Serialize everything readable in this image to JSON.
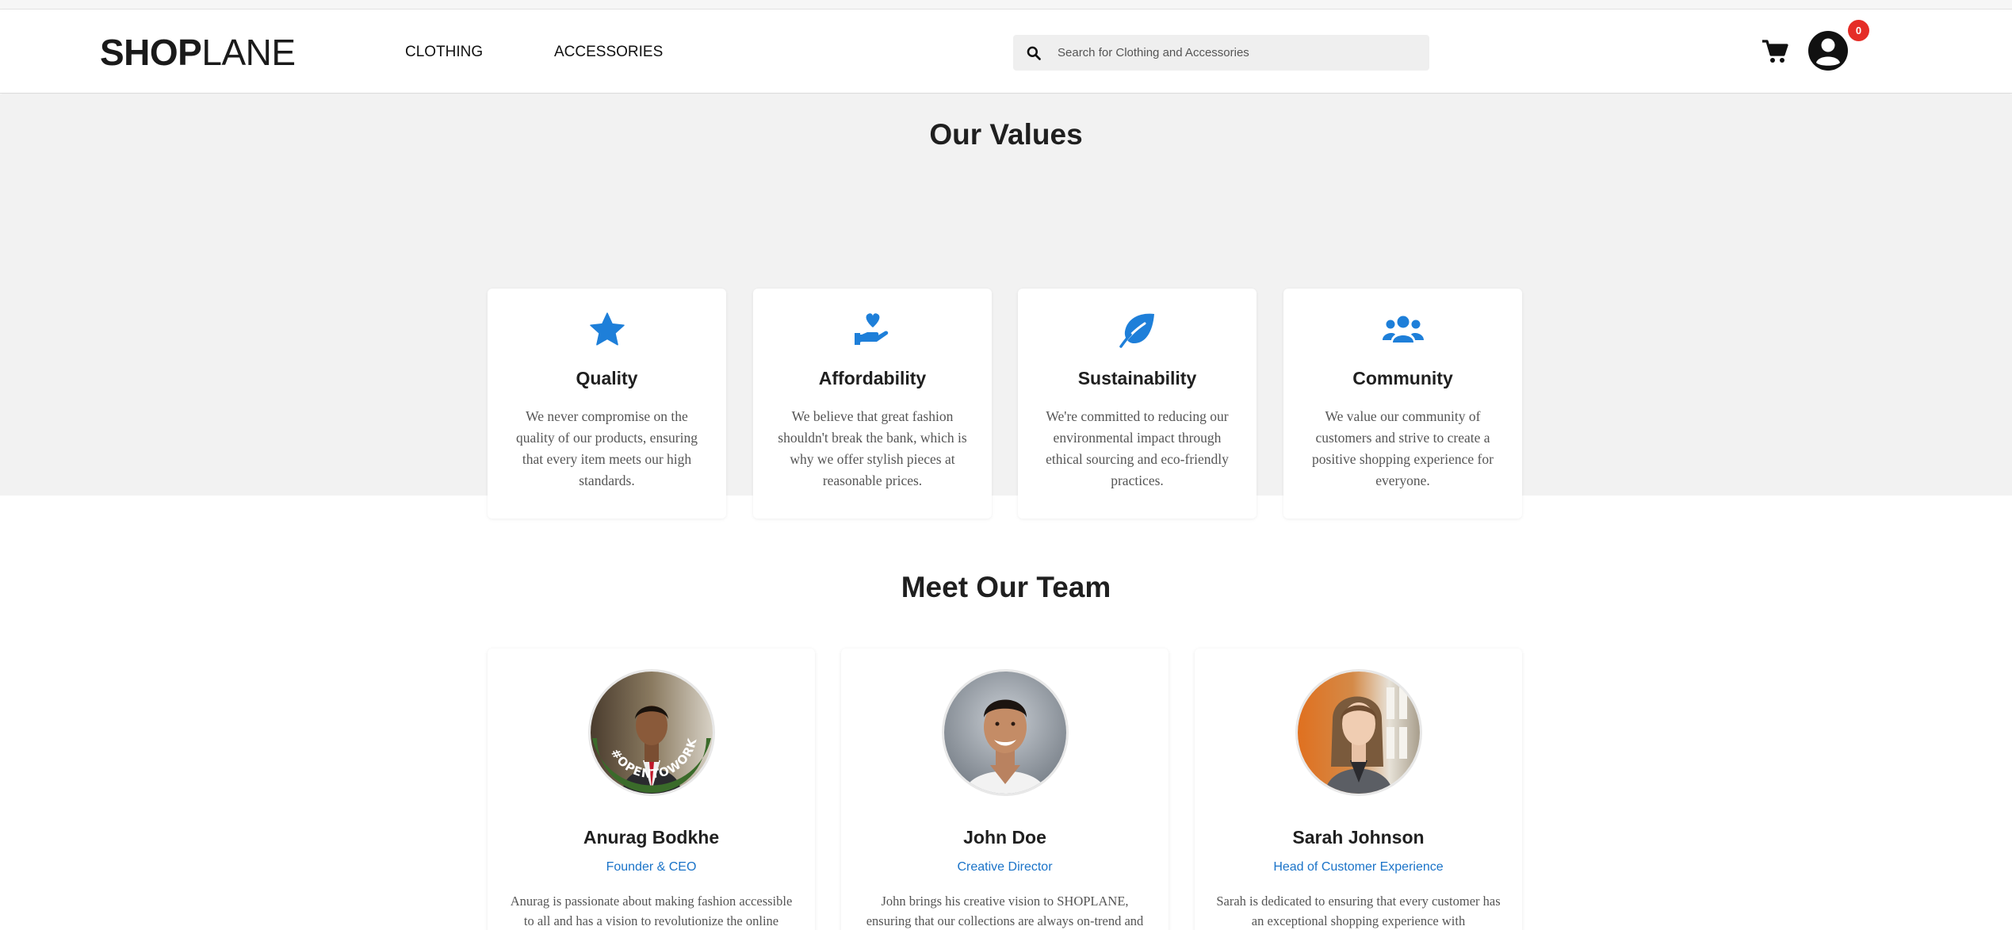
{
  "header": {
    "logo_bold": "SHOP",
    "logo_light": "LANE",
    "nav": [
      "CLOTHING",
      "ACCESSORIES"
    ],
    "search_placeholder": "Search for Clothing and Accessories",
    "cart_icon": "cart-icon",
    "account_icon": "user-circle-icon",
    "cart_count": "0"
  },
  "values": {
    "title": "Our Values",
    "items": [
      {
        "icon": "star-icon",
        "title": "Quality",
        "desc": "We never compromise on the quality of our products, ensuring that every item meets our high standards."
      },
      {
        "icon": "hand-holding-heart-icon",
        "title": "Affordability",
        "desc": "We believe that great fashion shouldn't break the bank, which is why we offer stylish pieces at reasonable prices."
      },
      {
        "icon": "leaf-icon",
        "title": "Sustainability",
        "desc": "We're committed to reducing our environmental impact through ethical sourcing and eco-friendly practices."
      },
      {
        "icon": "users-icon",
        "title": "Community",
        "desc": "We value our community of customers and strive to create a positive shopping experience for everyone."
      }
    ]
  },
  "team": {
    "title": "Meet Our Team",
    "members": [
      {
        "name": "Anurag Bodkhe",
        "role": "Founder & CEO",
        "desc": "Anurag is passionate about making fashion accessible to all and has a vision to revolutionize the online",
        "badge_text": "#OPENTOWORK"
      },
      {
        "name": "John Doe",
        "role": "Creative Director",
        "desc": "John brings his creative vision to SHOPLANE, ensuring that our collections are always on-trend and"
      },
      {
        "name": "Sarah Johnson",
        "role": "Head of Customer Experience",
        "desc": "Sarah is dedicated to ensuring that every customer has an exceptional shopping experience with"
      }
    ]
  },
  "colors": {
    "accent_blue": "#1e7fd9",
    "role_blue": "#1a73c8",
    "badge_red": "#e52d27",
    "section_bg": "#f2f2f2"
  }
}
